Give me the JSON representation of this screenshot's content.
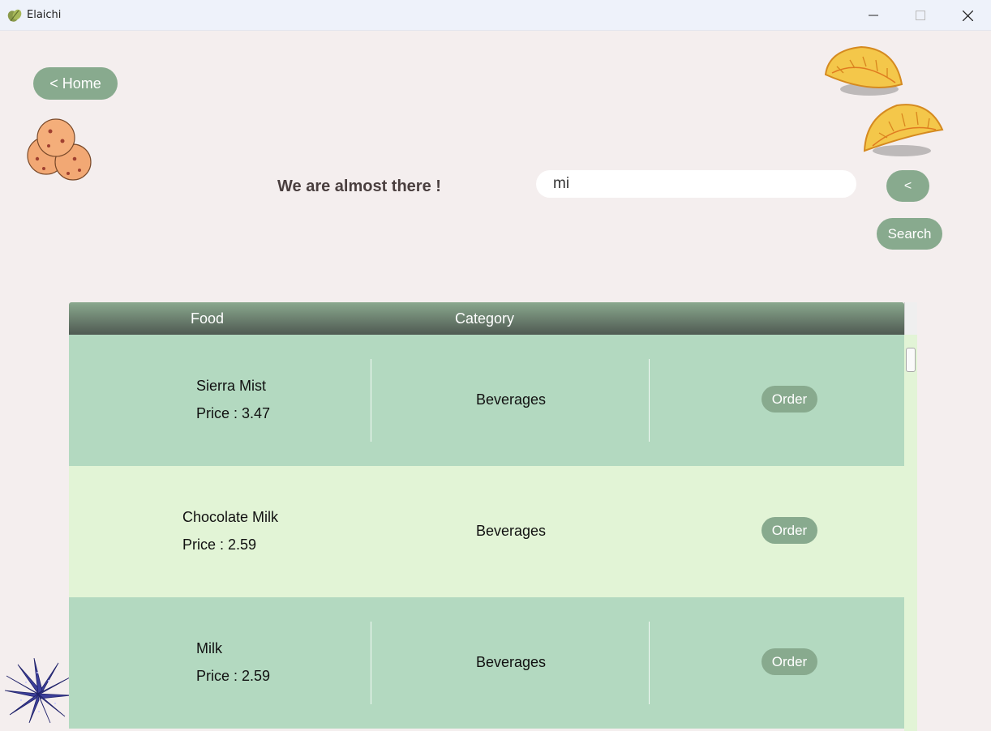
{
  "window": {
    "title": "Elaichi"
  },
  "nav": {
    "home_label": "< Home",
    "back_label": "<",
    "search_label": "Search"
  },
  "heading": "We are almost there !",
  "search": {
    "value": "mi"
  },
  "table": {
    "columns": [
      "Food",
      "Category"
    ],
    "price_prefix": "Price : ",
    "order_label": "Order",
    "rows": [
      {
        "name": "Sierra Mist",
        "price": "3.47",
        "category": "Beverages"
      },
      {
        "name": "Chocolate Milk",
        "price": "2.59",
        "category": "Beverages"
      },
      {
        "name": "Milk",
        "price": "2.59",
        "category": "Beverages"
      }
    ]
  },
  "colors": {
    "button": "#88aa8e",
    "row_dark": "#b3d9c0",
    "row_light": "#e2f4d6",
    "background": "#f4eeee"
  },
  "icons": [
    "leaf-app-icon",
    "cookies-icon",
    "empanada-icon",
    "plant-icon"
  ]
}
